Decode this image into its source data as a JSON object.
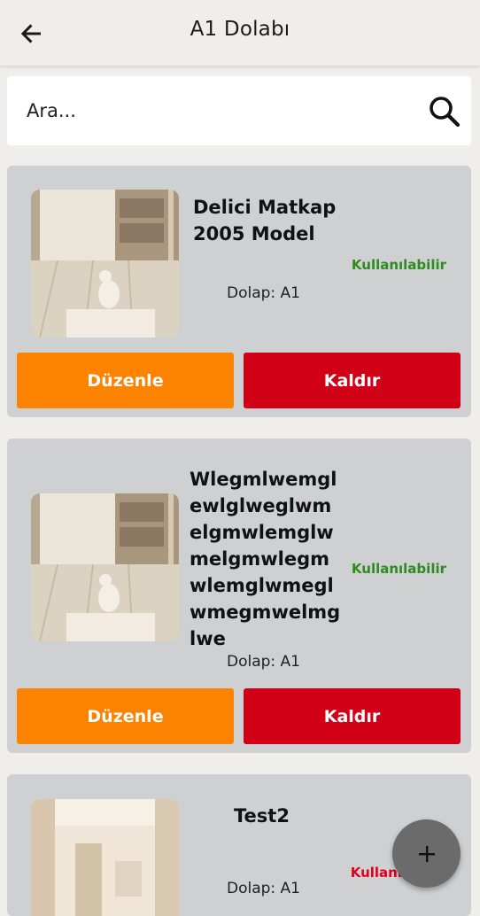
{
  "appbar": {
    "title": "A1 Dolabı",
    "back_icon": "arrow-left-icon"
  },
  "search": {
    "placeholder": "Ara...",
    "icon": "search-icon"
  },
  "items": [
    {
      "name": "Delici Matkap 2005 Model",
      "status": "Kullanılabilir",
      "status_color": "#2e8b1f",
      "locker": "Dolap: A1",
      "edit_label": "Düzenle",
      "remove_label": "Kaldır"
    },
    {
      "name": "Wlegmlwemglewlglweglwmelgmwlemglwmelgmwlegmwlemglwmeglwmegmwelmglwe",
      "status": "Kullanılabilir",
      "status_color": "#2e8b1f",
      "locker": "Dolap: A1",
      "edit_label": "Düzenle",
      "remove_label": "Kaldır"
    },
    {
      "name": "Test2",
      "status": "Kullanı",
      "status_color": "#e3001b",
      "locker": "Dolap: A1"
    }
  ],
  "fab": {
    "icon": "plus-icon"
  },
  "colors": {
    "background": "#efeeea",
    "card": "#cfd0d2",
    "edit_button": "#fb8300",
    "remove_button": "#d10017",
    "fab": "#6b6b6b"
  }
}
